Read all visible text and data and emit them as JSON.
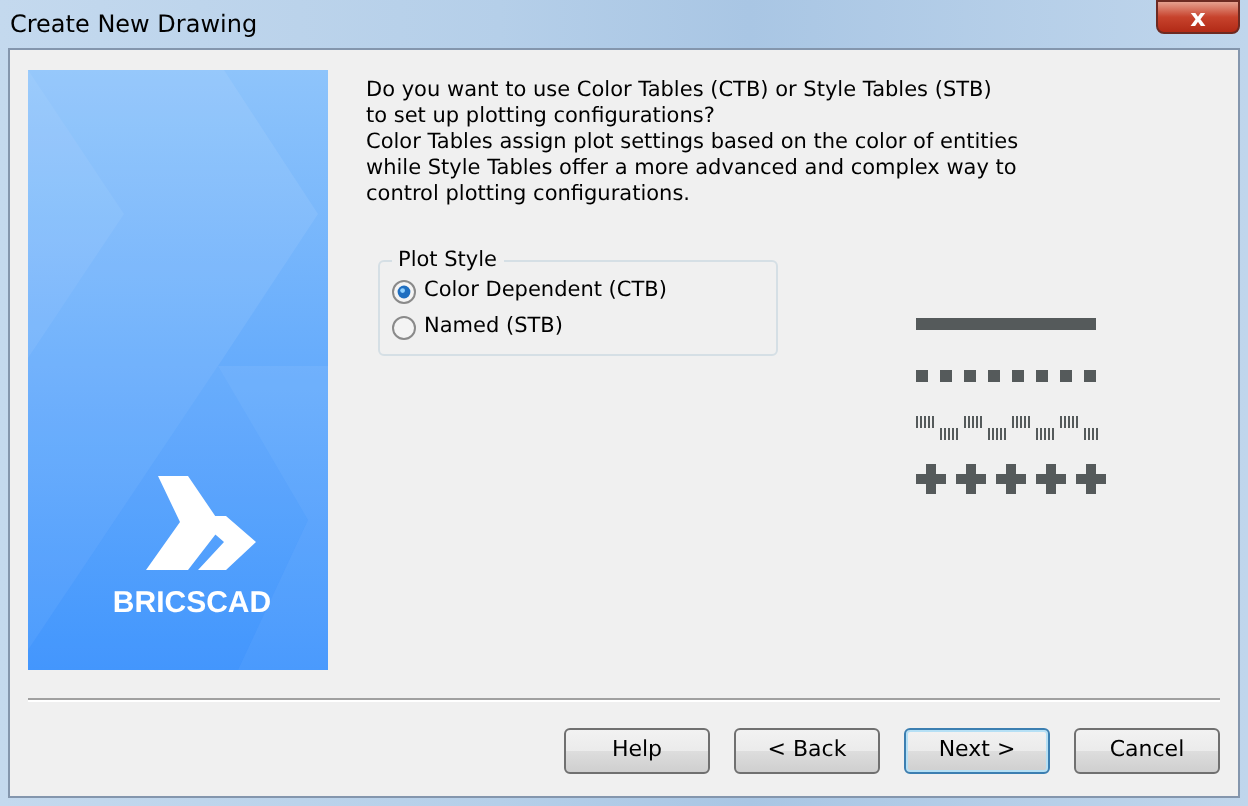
{
  "window": {
    "title": "Create New Drawing",
    "close_label": "x"
  },
  "sidebar": {
    "logo_text": "BRICSCAD"
  },
  "description": [
    "Do you want to use Color Tables (CTB) or Style Tables (STB)",
    "to set up plotting configurations?",
    "Color Tables assign plot settings based on the color of entities",
    "while Style Tables offer a more advanced and complex way to",
    "control plotting configurations."
  ],
  "plot_style": {
    "title": "Plot Style",
    "options": [
      {
        "label": "Color Dependent (CTB)",
        "selected": true
      },
      {
        "label": "Named (STB)",
        "selected": false
      }
    ]
  },
  "line_samples": [
    {
      "kind": "solid"
    },
    {
      "kind": "dashed"
    },
    {
      "kind": "barcode"
    },
    {
      "kind": "cross"
    }
  ],
  "buttons": [
    {
      "label": "Help",
      "focused": false
    },
    {
      "label": "< Back",
      "focused": false
    },
    {
      "label": "Next >",
      "focused": true
    },
    {
      "label": "Cancel",
      "focused": false
    }
  ]
}
